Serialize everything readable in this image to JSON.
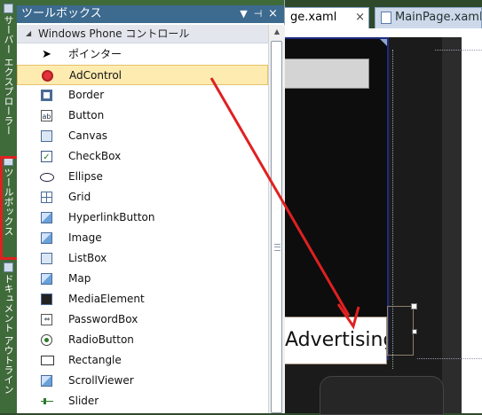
{
  "side_strip": {
    "tabs": [
      {
        "label": "サーバー エクスプローラー",
        "icon": "server-explorer-icon"
      },
      {
        "label": "ツールボックス",
        "icon": "toolbox-icon"
      },
      {
        "label": "ドキュメント アウトライン",
        "icon": "document-outline-icon"
      }
    ]
  },
  "toolbox": {
    "title": "ツールボックス",
    "dropdown_glyph": "▼",
    "pin_glyph": "⊣",
    "close_glyph": "×",
    "section": {
      "label": "Windows Phone コントロール",
      "expanded": true
    },
    "items": [
      {
        "label": "ポインター",
        "icon": "pointer-icon"
      },
      {
        "label": "AdControl",
        "icon": "adcontrol-icon",
        "selected": true
      },
      {
        "label": "Border",
        "icon": "border-icon"
      },
      {
        "label": "Button",
        "icon": "button-icon"
      },
      {
        "label": "Canvas",
        "icon": "canvas-icon"
      },
      {
        "label": "CheckBox",
        "icon": "checkbox-icon"
      },
      {
        "label": "Ellipse",
        "icon": "ellipse-icon"
      },
      {
        "label": "Grid",
        "icon": "grid-icon"
      },
      {
        "label": "HyperlinkButton",
        "icon": "hyperlinkbutton-icon"
      },
      {
        "label": "Image",
        "icon": "image-icon"
      },
      {
        "label": "ListBox",
        "icon": "listbox-icon"
      },
      {
        "label": "Map",
        "icon": "map-icon"
      },
      {
        "label": "MediaElement",
        "icon": "mediaelement-icon"
      },
      {
        "label": "PasswordBox",
        "icon": "passwordbox-icon"
      },
      {
        "label": "RadioButton",
        "icon": "radiobutton-icon"
      },
      {
        "label": "Rectangle",
        "icon": "rectangle-icon"
      },
      {
        "label": "ScrollViewer",
        "icon": "scrollviewer-icon"
      },
      {
        "label": "Slider",
        "icon": "slider-icon"
      }
    ]
  },
  "editor": {
    "tabs": [
      {
        "label": "ge.xaml",
        "close_glyph": "×",
        "active": true
      },
      {
        "label": "MainPage.xaml.c",
        "active": false
      }
    ],
    "ad_control_text": "Advertising"
  },
  "annotation": {
    "highlight_color": "#e02020",
    "arrow_color": "#e02020"
  }
}
